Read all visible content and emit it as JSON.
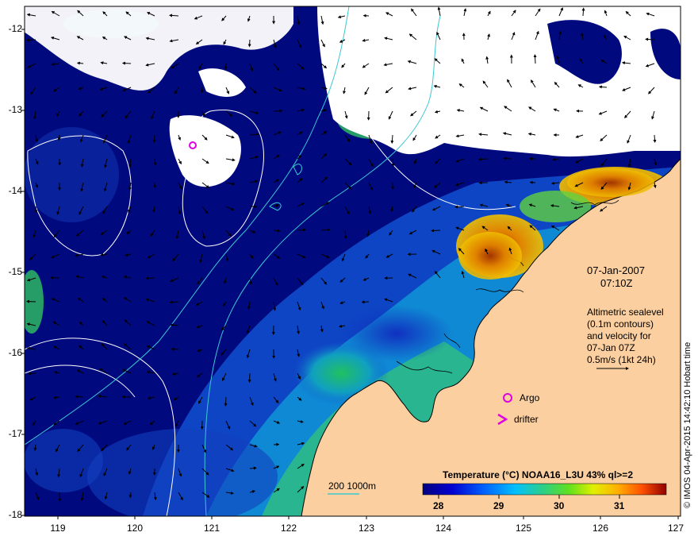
{
  "map": {
    "date": "07-Jan-2007",
    "time": "07:10Z",
    "annotation_lines": [
      "Altimetric sealevel",
      "(0.1m contours)",
      "and velocity for",
      "07-Jan 07Z",
      "0.5m/s (1kt 24h)"
    ],
    "argo_label": "Argo",
    "drifter_label": "drifter",
    "isobath_label": "200  1000m",
    "colorbar_title": "Temperature (°C) NOAA16_L3U 43% ql>=2",
    "colorbar_ticks": [
      "28",
      "29",
      "30",
      "31"
    ],
    "credit": "© IMOS 04-Apr-2015 14:42:10 Hobart time",
    "lat_ticks": [
      "-12",
      "-13",
      "-14",
      "-15",
      "-16",
      "-17",
      "-18"
    ],
    "lon_ticks": [
      "119",
      "120",
      "121",
      "122",
      "123",
      "124",
      "125",
      "126",
      "127"
    ],
    "colors": {
      "land": "#fbcf9f",
      "cloud": "#ffffff",
      "deep_sst": "#000a7e",
      "argo": "#e000e0",
      "contour": "#ffffff",
      "isobath": "#3cc8d2"
    }
  }
}
